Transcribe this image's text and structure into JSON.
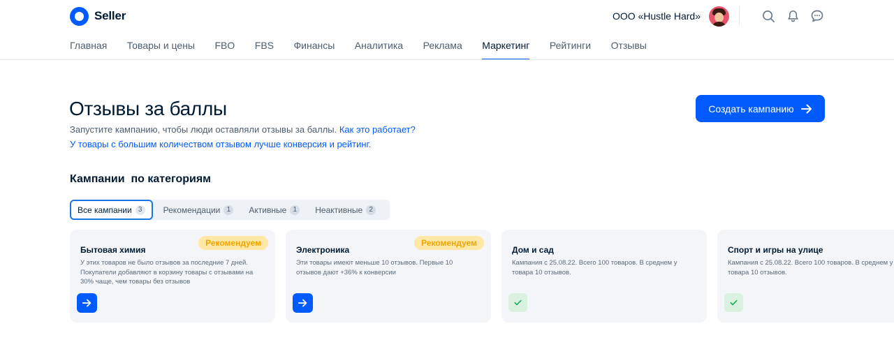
{
  "header": {
    "logo_text": "Seller",
    "company": "ООО «Hustle Hard»",
    "icons": [
      "search-icon",
      "bell-icon",
      "chat-icon"
    ]
  },
  "nav": {
    "items": [
      {
        "label": "Главная",
        "active": false
      },
      {
        "label": "Товары и цены",
        "active": false
      },
      {
        "label": "FBO",
        "active": false
      },
      {
        "label": "FBS",
        "active": false
      },
      {
        "label": "Финансы",
        "active": false
      },
      {
        "label": "Аналитика",
        "active": false
      },
      {
        "label": "Реклама",
        "active": false
      },
      {
        "label": "Маркетинг",
        "active": true
      },
      {
        "label": "Рейтинги",
        "active": false
      },
      {
        "label": "Отзывы",
        "active": false
      }
    ]
  },
  "page": {
    "title": "Отзывы за баллы",
    "subtitle_line1": "Запустите кампанию, чтобы люди оставляли отзывы за баллы.",
    "subtitle_link1": "Как это работает?",
    "subtitle_line2_prefix": "У товары с большим количеством отзывом",
    "subtitle_link2": "лучше конверсия и рейтинг",
    "subtitle_line2_suffix": ".",
    "create_button": "Создать кампанию",
    "section_title": "Кампании  по категориям"
  },
  "filters": [
    {
      "label": "Все кампании",
      "count": "3",
      "active": true
    },
    {
      "label": "Рекомендации",
      "count": "1",
      "active": false
    },
    {
      "label": "Активные",
      "count": "1",
      "active": false
    },
    {
      "label": "Неактивные",
      "count": "2",
      "active": false
    }
  ],
  "cards": [
    {
      "title": "Бытовая химия",
      "badge": "Рекомендуем",
      "description": "У этих товаров не было отзывов за последние 7 дней. Покупатели добавляют в корзину товары с отзывами на 30% чаще, чем товары без отзывов",
      "action": "go"
    },
    {
      "title": "Электроника",
      "badge": "Рекомендуем",
      "description": "Эти товары имеют меньше 10 отзывов. Первые 10 отзывов дают +36% к конверсии",
      "action": "go"
    },
    {
      "title": "Дом и сад",
      "badge": "",
      "description": "Кампания с 25.08.22. Всего 100 товаров. В среднем у товара 10 отзывов.",
      "action": "done"
    },
    {
      "title": "Спорт и игры на улице",
      "badge": "",
      "description": "Кампания с 25.08.22. Всего 100 товаров. В среднем у товара 10 отзывов.",
      "action": "done"
    }
  ],
  "colors": {
    "accent": "#005bff",
    "badge_bg": "#ffe8a6",
    "badge_text": "#f0a400",
    "done_bg": "#d9f2df",
    "done_check": "#1fae55"
  }
}
